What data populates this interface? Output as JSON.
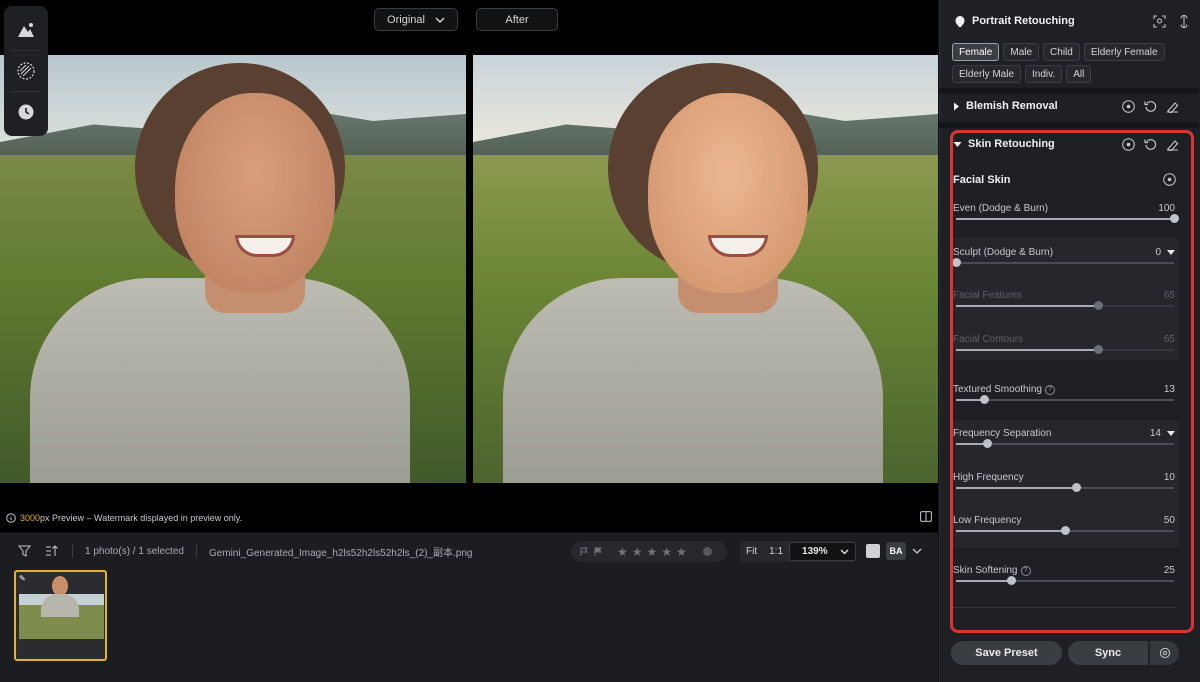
{
  "view_switch": {
    "original": "Original",
    "after": "After"
  },
  "tools": [
    "adjust-icon",
    "texture-icon",
    "history-icon"
  ],
  "preview_note": {
    "size": "3000",
    "text": "px Preview – Watermark displayed in preview only."
  },
  "filmstrip": {
    "count": "1 photo(s) / 1 selected",
    "filename": "Gemini_Generated_Image_h2ls52h2ls52h2ls_(2)_副本.png",
    "zoom_fit": "Fit",
    "zoom_1to1": "1:1",
    "zoom_value": "139%",
    "ba_label": "BA"
  },
  "panel": {
    "title": "Portrait Retouching",
    "chips": [
      "Female",
      "Male",
      "Child",
      "Elderly Female",
      "Elderly Male",
      "Indiv.",
      "All"
    ],
    "active_chip": "Female",
    "blemish": "Blemish Removal",
    "skin": "Skin Retouching",
    "facial_skin": "Facial Skin",
    "sliders": [
      {
        "label": "Even (Dodge & Burn)",
        "value": "100",
        "level": 1.0
      },
      {
        "label": "Sculpt (Dodge & Burn)",
        "value": "0",
        "level": 0.0
      },
      {
        "label": "Facial Features",
        "value": "65",
        "level": 0.65
      },
      {
        "label": "Facial Contours",
        "value": "65",
        "level": 0.65
      },
      {
        "label": "Textured Smoothing",
        "value": "13",
        "level": 0.13
      },
      {
        "label": "Frequency Separation",
        "value": "14",
        "level": 0.14
      },
      {
        "label": "High Frequency",
        "value": "10",
        "level": 0.55
      },
      {
        "label": "Low Frequency",
        "value": "50",
        "level": 0.5
      },
      {
        "label": "Skin Softening",
        "value": "25",
        "level": 0.25
      }
    ],
    "save_preset": "Save Preset",
    "sync": "Sync"
  },
  "colors": {
    "accent": "#e0b23a",
    "highlight": "#e03232"
  }
}
